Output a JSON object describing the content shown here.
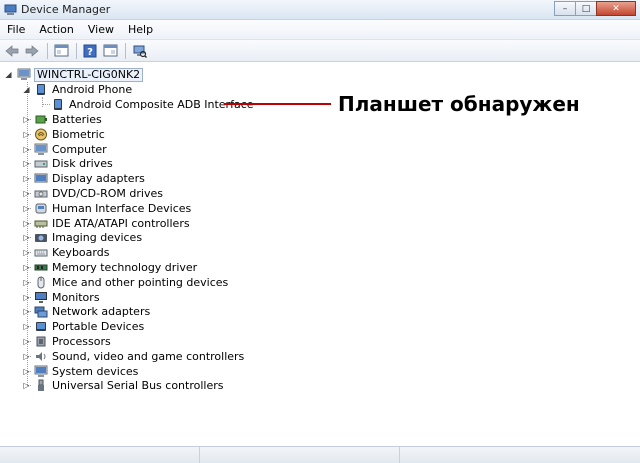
{
  "window": {
    "title": "Device Manager",
    "buttons": {
      "minimize": "–",
      "maximize": "□",
      "close": "✕"
    }
  },
  "menu": [
    {
      "label": "File"
    },
    {
      "label": "Action"
    },
    {
      "label": "View"
    },
    {
      "label": "Help"
    }
  ],
  "toolbar": [
    "back-icon",
    "forward-icon",
    "properties-window-icon",
    "help-icon",
    "show-hide-console-tree-icon",
    "scan-hardware-icon"
  ],
  "tree": {
    "root": "WINCTRL-CIG0NK2",
    "expanded_category": {
      "label": "Android Phone",
      "child": "Android Composite ADB Interface"
    },
    "categories": [
      {
        "label": "Batteries",
        "icon": "battery-icon"
      },
      {
        "label": "Biometric",
        "icon": "fingerprint-icon"
      },
      {
        "label": "Computer",
        "icon": "computer-icon"
      },
      {
        "label": "Disk drives",
        "icon": "disk-drive-icon"
      },
      {
        "label": "Display adapters",
        "icon": "display-adapter-icon"
      },
      {
        "label": "DVD/CD-ROM drives",
        "icon": "dvd-drive-icon"
      },
      {
        "label": "Human Interface Devices",
        "icon": "hid-icon"
      },
      {
        "label": "IDE ATA/ATAPI controllers",
        "icon": "ide-controller-icon"
      },
      {
        "label": "Imaging devices",
        "icon": "camera-icon"
      },
      {
        "label": "Keyboards",
        "icon": "keyboard-icon"
      },
      {
        "label": "Memory technology driver",
        "icon": "memory-icon"
      },
      {
        "label": "Mice and other pointing devices",
        "icon": "mouse-icon"
      },
      {
        "label": "Monitors",
        "icon": "monitor-icon"
      },
      {
        "label": "Network adapters",
        "icon": "network-adapter-icon"
      },
      {
        "label": "Portable Devices",
        "icon": "portable-device-icon"
      },
      {
        "label": "Processors",
        "icon": "processor-icon"
      },
      {
        "label": "Sound, video and game controllers",
        "icon": "speaker-icon"
      },
      {
        "label": "System devices",
        "icon": "system-device-icon"
      },
      {
        "label": "Universal Serial Bus controllers",
        "icon": "usb-icon"
      }
    ]
  },
  "annotation": {
    "text": "Планшет обнаружен",
    "color": "#c00000"
  }
}
